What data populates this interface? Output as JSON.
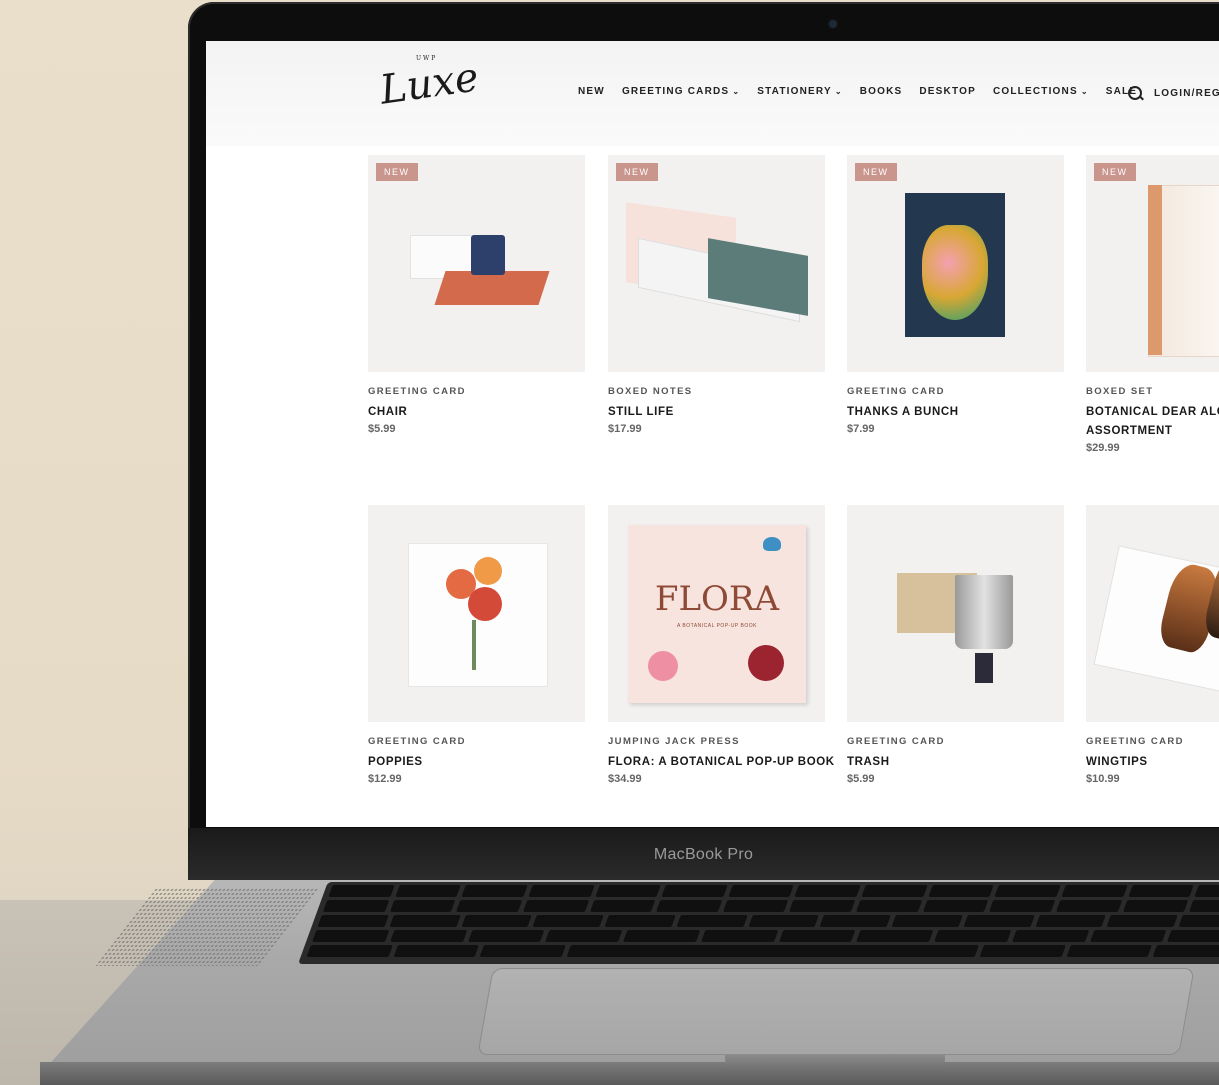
{
  "device": {
    "brand_label": "MacBook Pro"
  },
  "site": {
    "logo": {
      "small": "UWP",
      "main": "Luxe"
    },
    "nav": [
      {
        "label": "NEW",
        "dropdown": false
      },
      {
        "label": "GREETING CARDS",
        "dropdown": true
      },
      {
        "label": "STATIONERY",
        "dropdown": true
      },
      {
        "label": "BOOKS",
        "dropdown": false
      },
      {
        "label": "DESKTOP",
        "dropdown": false
      },
      {
        "label": "COLLECTIONS",
        "dropdown": true
      },
      {
        "label": "SALE",
        "dropdown": false
      }
    ],
    "login_label": "LOGIN/REGI",
    "badge_label": "NEW"
  },
  "products": [
    {
      "category": "GREETING CARD",
      "name": "CHAIR",
      "price": "$5.99",
      "badge": true
    },
    {
      "category": "BOXED NOTES",
      "name": "STILL LIFE",
      "price": "$17.99",
      "badge": true
    },
    {
      "category": "GREETING CARD",
      "name": "THANKS A BUNCH",
      "price": "$7.99",
      "badge": true
    },
    {
      "category": "BOXED SET",
      "name": "BOTANICAL DEAR ALCH",
      "name2": "ASSORTMENT",
      "price": "$29.99",
      "badge": true
    },
    {
      "category": "GREETING CARD",
      "name": "POPPIES",
      "price": "$12.99",
      "badge": false
    },
    {
      "category": "JUMPING JACK PRESS",
      "name": "FLORA: A BOTANICAL POP-UP BOOK",
      "price": "$34.99",
      "badge": false,
      "cover_title": "FLORA",
      "cover_subtitle": "A BOTANICAL POP-UP BOOK"
    },
    {
      "category": "GREETING CARD",
      "name": "TRASH",
      "price": "$5.99",
      "badge": false
    },
    {
      "category": "GREETING CARD",
      "name": "WINGTIPS",
      "price": "$10.99",
      "badge": false
    }
  ],
  "colors": {
    "badge": "#c9958d",
    "tile_bg": "#f2f1ef"
  }
}
